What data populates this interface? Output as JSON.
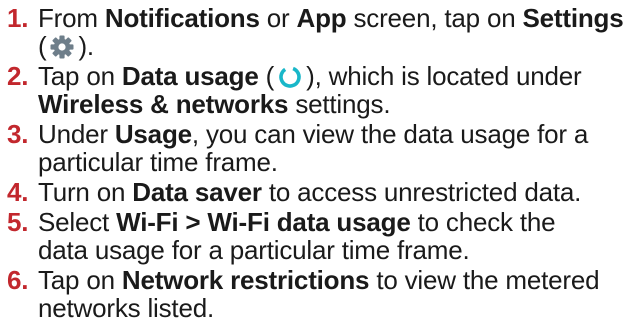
{
  "steps": [
    {
      "number": "1.",
      "t1": "From ",
      "b1": "Notifications",
      "t2": " or ",
      "b2": "App",
      "t3": " screen, tap on ",
      "b3": "Settings",
      "t4": "(",
      "icon": "settings-gear-icon",
      "t5": ")."
    },
    {
      "number": "2.",
      "t1": "Tap on ",
      "b1": "Data usage",
      "t2": " (",
      "icon": "data-usage-ring-icon",
      "t3": "), which is located under",
      "b2": "Wireless & networks",
      "t4": " settings."
    },
    {
      "number": "3.",
      "t1": "Under ",
      "b1": "Usage",
      "t2": ", you can view the data usage for a",
      "t3": "particular time frame."
    },
    {
      "number": "4.",
      "t1": "Turn on ",
      "b1": "Data saver",
      "t2": " to access unrestricted data."
    },
    {
      "number": "5.",
      "t1": "Select ",
      "b1": "Wi-Fi > Wi-Fi data usage",
      "t2": " to check the",
      "t3": "data usage for a particular time frame."
    },
    {
      "number": "6.",
      "t1": "Tap on ",
      "b1": "Network restrictions",
      "t2": " to view the metered",
      "t3": "networks listed."
    }
  ],
  "colors": {
    "step_number": "#c2272d",
    "text": "#1a1a1a",
    "gear_icon": "#6e7e8a",
    "ring_icon": "#19b7c9"
  }
}
